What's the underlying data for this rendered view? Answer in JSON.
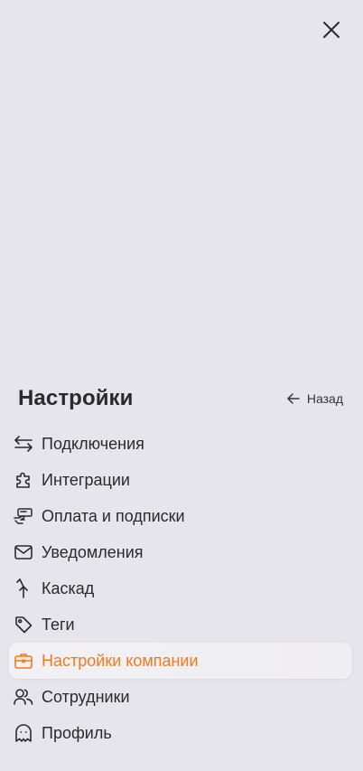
{
  "close": {
    "icon": "close-icon"
  },
  "header": {
    "title": "Настройки",
    "back_label": "Назад",
    "back_icon": "arrow-left-icon"
  },
  "menu": {
    "items": [
      {
        "label": "Подключения",
        "icon": "arrows-swap-icon",
        "active": false
      },
      {
        "label": "Интеграции",
        "icon": "puzzle-icon",
        "active": false
      },
      {
        "label": "Оплата и подписки",
        "icon": "payment-hand-icon",
        "active": false
      },
      {
        "label": "Уведомления",
        "icon": "envelope-icon",
        "active": false
      },
      {
        "label": "Каскад",
        "icon": "cascade-merge-icon",
        "active": false
      },
      {
        "label": "Теги",
        "icon": "tag-icon",
        "active": false
      },
      {
        "label": "Настройки компании",
        "icon": "briefcase-icon",
        "active": true
      },
      {
        "label": "Сотрудники",
        "icon": "users-icon",
        "active": false
      },
      {
        "label": "Профиль",
        "icon": "ghost-icon",
        "active": false
      }
    ]
  },
  "colors": {
    "background": "#e6e5eb",
    "text": "#2a2a2e",
    "accent": "#f27a1a"
  }
}
